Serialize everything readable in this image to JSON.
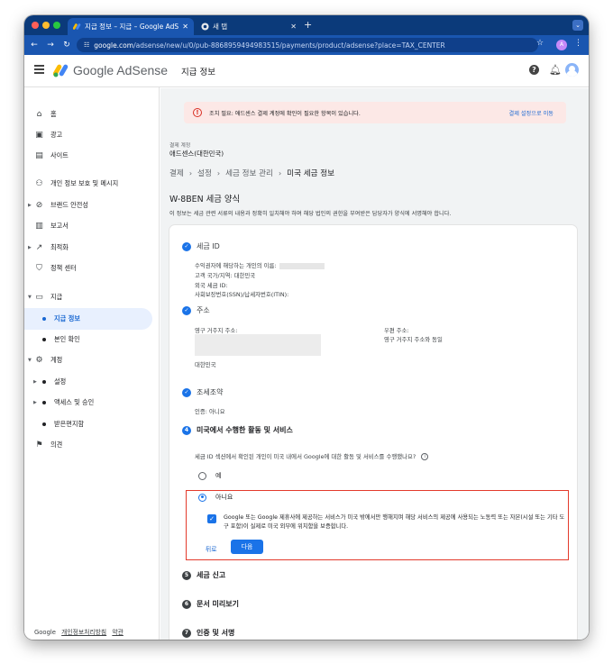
{
  "browser": {
    "tabs": [
      {
        "title": "지급 정보 – 지급 – Google AdSense",
        "active": true
      },
      {
        "title": "새 탭",
        "active": false
      }
    ],
    "new_tab_label": "+",
    "url_host": "google.com",
    "url_path": "/adsense/new/u/0/pub-8868959494983515/payments/product/adsense?place=TAX_CENTER",
    "profile_initial": "A"
  },
  "header": {
    "app_name": "Google AdSense",
    "page_title": "지급 정보",
    "help_label": "?"
  },
  "sidebar": {
    "items": [
      {
        "label": "홈",
        "icon": "home-icon"
      },
      {
        "label": "광고",
        "icon": "ads-icon"
      },
      {
        "label": "사이트",
        "icon": "sites-icon"
      },
      {
        "label": "개인 정보 보호 및 메시지",
        "icon": "privacy-icon"
      },
      {
        "label": "브랜드 안전성",
        "icon": "block-icon"
      },
      {
        "label": "보고서",
        "icon": "reports-icon"
      },
      {
        "label": "최적화",
        "icon": "optimization-icon"
      },
      {
        "label": "정책 센터",
        "icon": "policy-icon"
      },
      {
        "label": "지급",
        "icon": "payments-icon"
      },
      {
        "label": "지급 정보",
        "icon": "bullet"
      },
      {
        "label": "본인 확인",
        "icon": "bullet"
      },
      {
        "label": "계정",
        "icon": "gear-icon"
      },
      {
        "label": "설정",
        "icon": "bullet"
      },
      {
        "label": "액세스 및 승인",
        "icon": "bullet"
      },
      {
        "label": "받은편지함",
        "icon": "bullet"
      },
      {
        "label": "의견",
        "icon": "feedback-icon"
      }
    ],
    "footer": {
      "brand": "Google",
      "privacy": "개인정보처리방침",
      "terms": "약관"
    }
  },
  "alert": {
    "text": "조치 필요: 애드센스 결제 계정에 확인이 필요한 항목이 있습니다.",
    "link": "결제 설정으로 이동"
  },
  "account": {
    "label": "결제 계정",
    "name": "애드센스(대한민국)"
  },
  "breadcrumb": [
    "결제",
    "설정",
    "세금 정보 관리",
    "미국 세금 정보"
  ],
  "form": {
    "title": "W-8BEN 세금 양식",
    "description": "이 정보는 세금 관련 서류의 내용과 정확히 일치해야 하며 해당 법인의 권한을 부여받은 담당자가 양식에 서명해야 합니다.",
    "steps": [
      {
        "number": "1",
        "title": "세금 ID",
        "status": "done"
      },
      {
        "number": "2",
        "title": "주소",
        "status": "done"
      },
      {
        "number": "3",
        "title": "조세조약",
        "status": "done"
      },
      {
        "number": "4",
        "title": "미국에서 수행한 활동 및 서비스",
        "status": "current"
      },
      {
        "number": "5",
        "title": "세금 신고",
        "status": "pending"
      },
      {
        "number": "6",
        "title": "문서 미리보기",
        "status": "pending"
      },
      {
        "number": "7",
        "title": "인증 및 서명",
        "status": "pending"
      }
    ],
    "tax_id": {
      "beneficiary": "수익권자에 해당하는 개인의 이름:",
      "country": "고객 국가/지역: 대한민국",
      "foreign_tax_id": "외국 세금 ID:",
      "ssn": "사회보장번호(SSN)/납세자번호(ITIN):"
    },
    "address": {
      "permanent_label": "영구 거주지 주소:",
      "country": "대한민국",
      "mailing_label": "우편 주소:",
      "mailing_value": "영구 거주지 주소와 동일"
    },
    "treaty": {
      "status": "인증: 아니요"
    },
    "activity": {
      "question": "세금 ID 섹션에서 확인된 개인이 미국 내에서 Google에 대한 활동 및 서비스를 수행했나요?",
      "option_yes": "예",
      "option_no": "아니요",
      "selected": "아니요",
      "certification": "Google 또는 Google 제휴사에 제공하는 서비스가 미국 밖에서만 행해지며 해당 서비스의 제공에 사용되는 노동력 또는 자본(시설 또는 기타 도구 포함)이 실제로 미국 외부에 위치함을 보증합니다.",
      "back_label": "뒤로",
      "next_label": "다음"
    }
  }
}
